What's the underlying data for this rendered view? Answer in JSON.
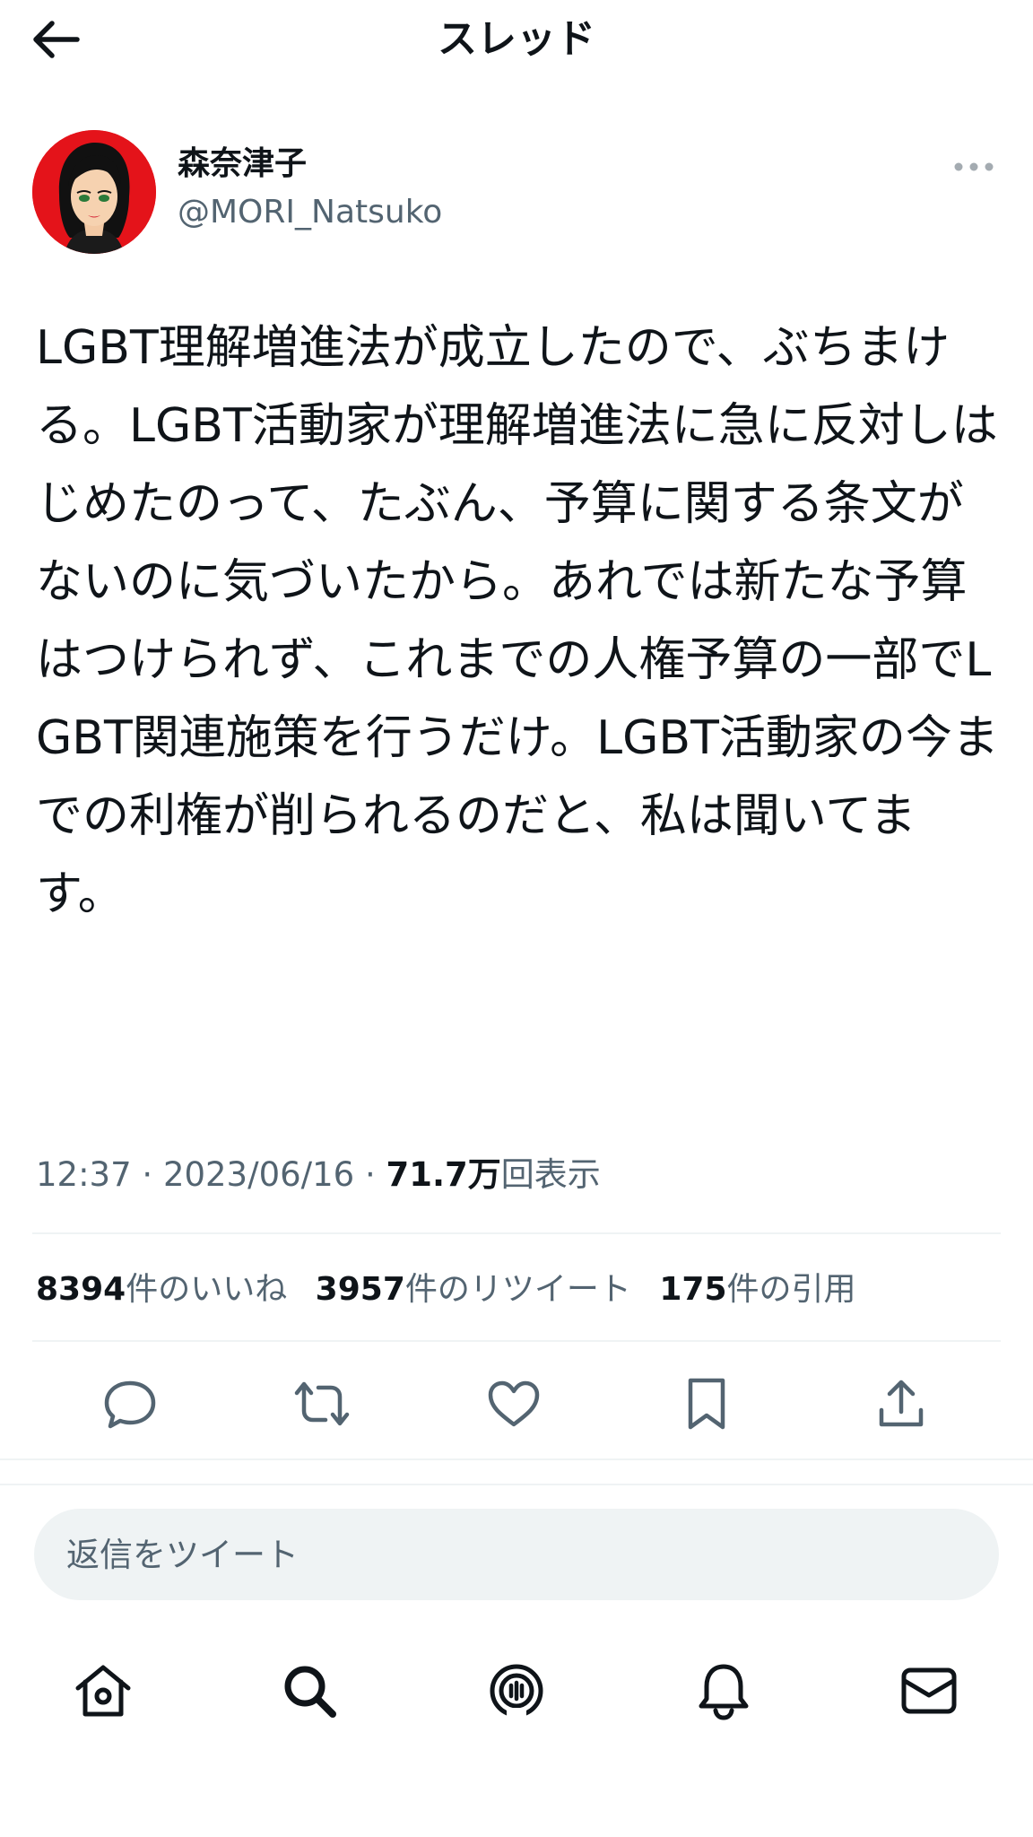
{
  "header": {
    "title": "スレッド",
    "back_icon": "arrow-left-icon"
  },
  "tweet": {
    "author": {
      "display_name": "森奈津子",
      "handle": "@MORI_Natsuko",
      "avatar_bg": "#e4131a"
    },
    "text": "LGBT理解増進法が成立したので、ぶちまける。LGBT活動家が理解増進法に急に反対しはじめたのって、たぶん、予算に関する条文がないのに気づいたから。あれでは新たな予算はつけられず、これまでの人権予算の一部でLGBT関連施策を行うだけ。LGBT活動家の今までの利権が削られるのだと、私は聞いてます。",
    "time": "12:37",
    "date": "2023/06/16",
    "separator": " · ",
    "views_count": "71.7万",
    "views_label": "回表示",
    "stats": {
      "likes_count": "8394",
      "likes_label": "件のいいね",
      "retweets_count": "3957",
      "retweets_label": "件のリツイート",
      "quotes_count": "175",
      "quotes_label": "件の引用"
    }
  },
  "actions": [
    "reply-icon",
    "retweet-icon",
    "like-icon",
    "bookmark-icon",
    "share-icon"
  ],
  "reply": {
    "placeholder": "返信をツイート"
  },
  "bottom_nav": [
    "home-icon",
    "search-icon",
    "spaces-icon",
    "notifications-icon",
    "messages-icon"
  ],
  "colors": {
    "text_primary": "#0f1419",
    "text_secondary": "#536471",
    "divider": "#eff3f4"
  }
}
